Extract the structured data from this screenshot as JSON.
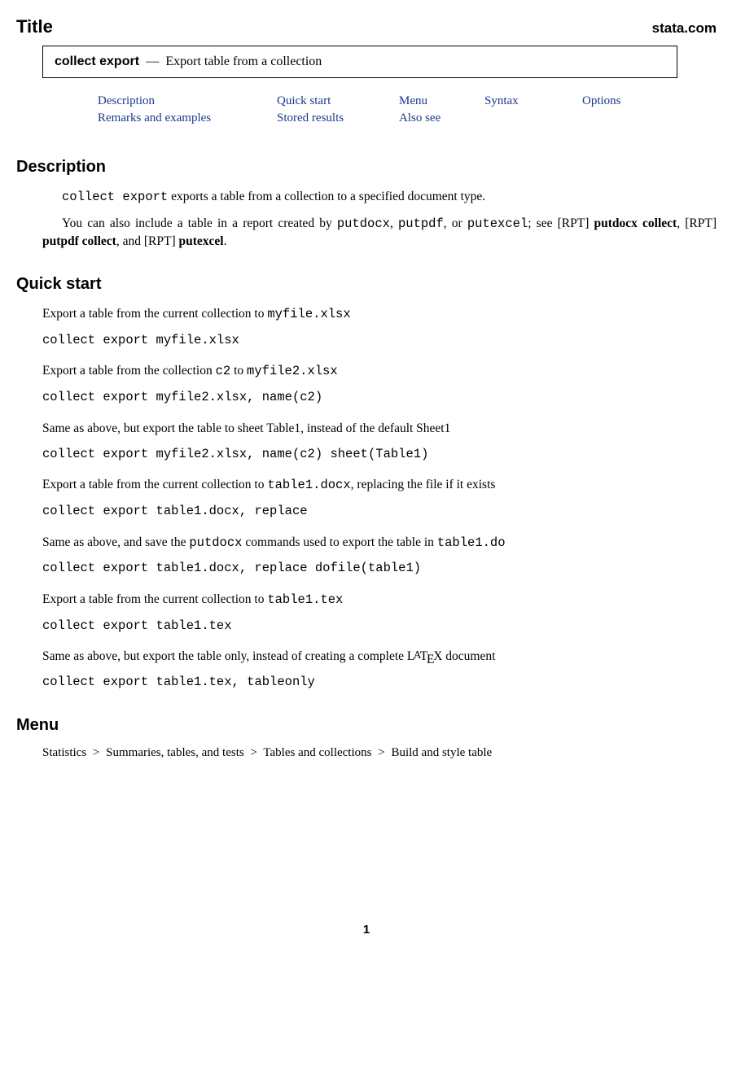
{
  "header": {
    "title": "Title",
    "site": "stata.com"
  },
  "titlebox": {
    "command": "collect export",
    "dash": "—",
    "subtitle": "Export table from a collection"
  },
  "toc": {
    "r1": {
      "c1": "Description",
      "c2": "Quick start",
      "c3": "Menu",
      "c4": "Syntax",
      "c5": "Options"
    },
    "r2": {
      "c1": "Remarks and examples",
      "c2": "Stored results",
      "c3": "Also see"
    }
  },
  "sections": {
    "description": "Description",
    "quickstart": "Quick start",
    "menu": "Menu"
  },
  "desc": {
    "p1a": "collect export",
    "p1b": " exports a table from a collection to a specified document type.",
    "p2a": "You can also include a table in a report created by ",
    "p2b": "putdocx",
    "p2c": ", ",
    "p2d": "putpdf",
    "p2e": ", or ",
    "p2f": "putexcel",
    "p2g": "; see ",
    "p2h": "[",
    "p2i": "RPT",
    "p2j": "] ",
    "p2k": "putdocx collect",
    "p2l": ", [",
    "p2m": "RPT",
    "p2n": "] ",
    "p2o": "putpdf collect",
    "p2p": ", and [",
    "p2q": "RPT",
    "p2r": "] ",
    "p2s": "putexcel",
    "p2t": "."
  },
  "qs": [
    {
      "d1": "Export a table from the current collection to ",
      "d2": "myfile.xlsx",
      "d3": "",
      "cmd": "collect export myfile.xlsx"
    },
    {
      "d1": "Export a table from the collection ",
      "d2": "c2",
      "d3": " to ",
      "d4": "myfile2.xlsx",
      "d5": "",
      "cmd": "collect export myfile2.xlsx, name(c2)"
    },
    {
      "d1": "Same as above, but export the table to sheet Table1, instead of the default Sheet1",
      "cmd": "collect export myfile2.xlsx, name(c2) sheet(Table1)"
    },
    {
      "d1": "Export a table from the current collection to ",
      "d2": "table1.docx",
      "d3": ", replacing the file if it exists",
      "cmd": "collect export table1.docx, replace"
    },
    {
      "d1": "Same as above, and save the ",
      "d2": "putdocx",
      "d3": " commands used to export the table in ",
      "d4": "table1.do",
      "d5": "",
      "cmd": "collect export table1.docx, replace dofile(table1)"
    },
    {
      "d1": "Export a table from the current collection to ",
      "d2": "table1.tex",
      "d3": "",
      "cmd": "collect export table1.tex"
    },
    {
      "d1": "Same as above, but export the table only, instead of creating a complete ",
      "latex": true,
      "d3": " document",
      "cmd": "collect export table1.tex, tableonly"
    }
  ],
  "menu": {
    "p1": "Statistics",
    "p2": "Summaries, tables, and tests",
    "p3": "Tables and collections",
    "p4": "Build and style table",
    "gt": ">"
  },
  "pagenum": "1"
}
